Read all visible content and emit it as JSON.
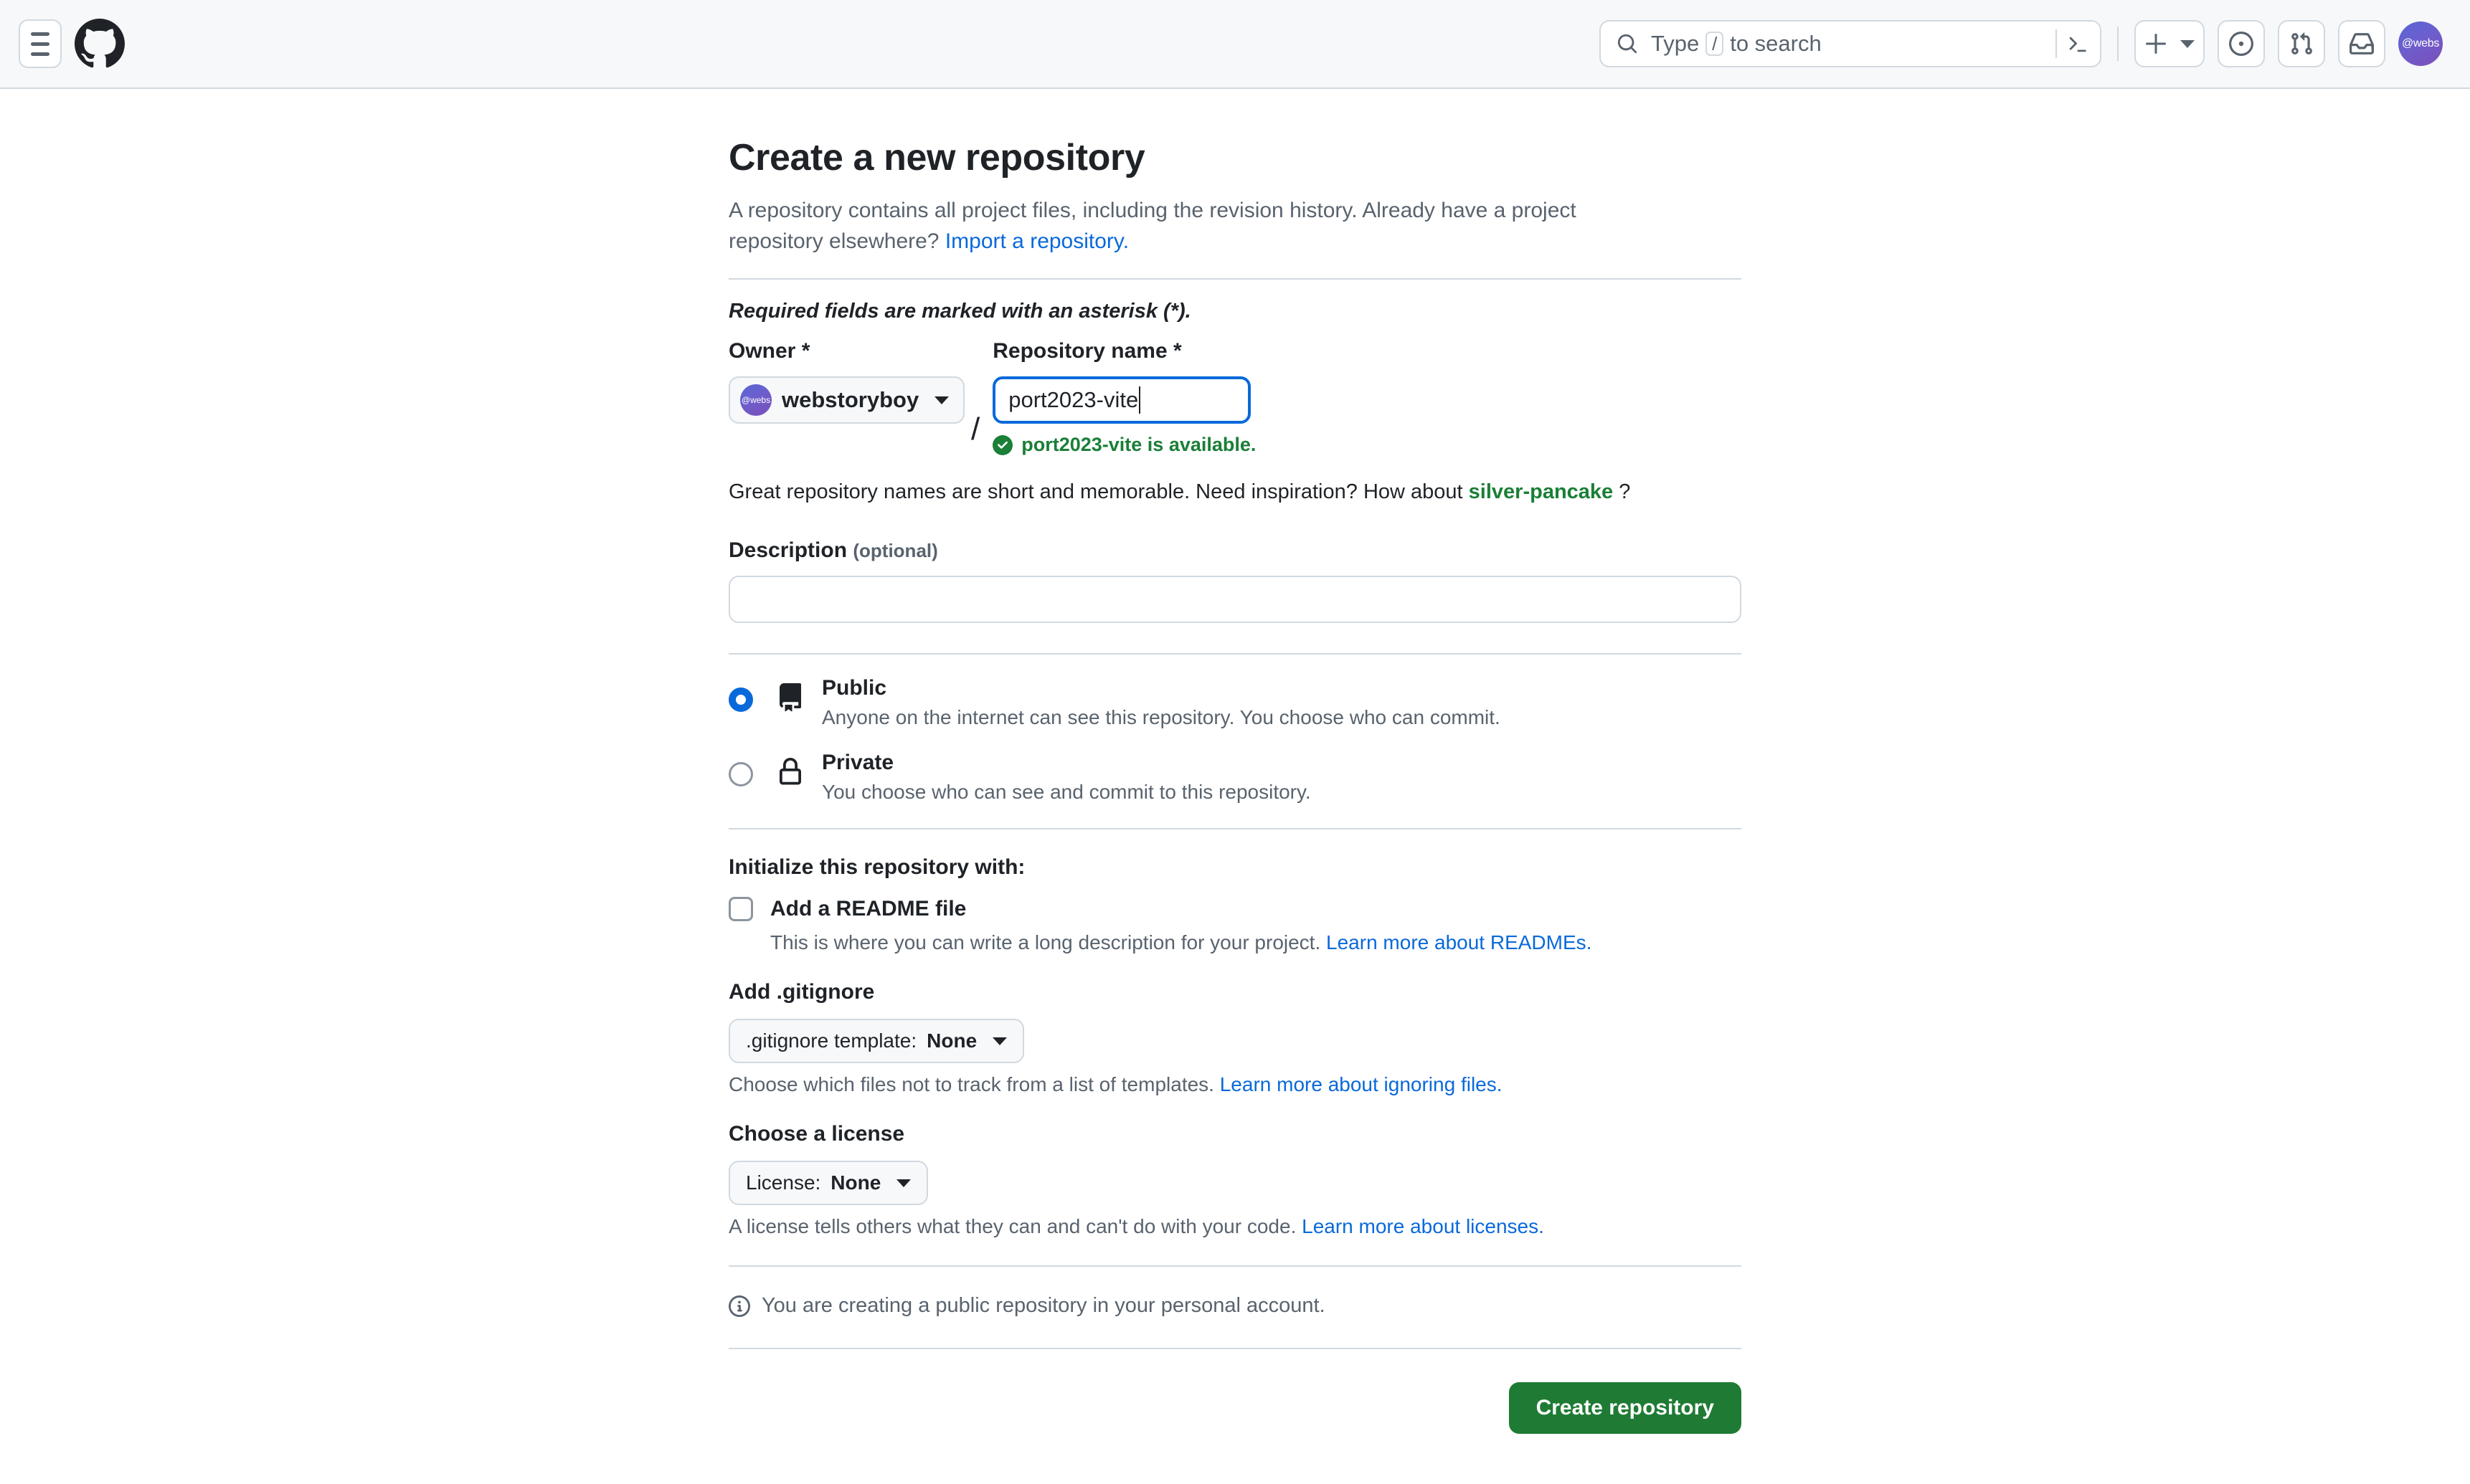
{
  "header": {
    "menu_icon": "hamburger-icon",
    "logo_icon": "github-logo-icon",
    "search": {
      "icon": "search-icon",
      "placeholder_prefix": "Type",
      "key_hint": "/",
      "placeholder_suffix": "to search",
      "terminal_icon": "terminal-icon"
    },
    "create_new_icon": "plus-icon",
    "issues_icon": "issue-opened-icon",
    "pull_requests_icon": "git-pull-request-icon",
    "notifications_icon": "inbox-icon",
    "avatar_label": "@webs"
  },
  "page": {
    "title": "Create a new repository",
    "lede_part1": "A repository contains all project files, including the revision history. Already have a project repository elsewhere?",
    "lede_link": "Import a repository.",
    "required_note": "Required fields are marked with an asterisk (*)."
  },
  "owner": {
    "label": "Owner *",
    "avatar_label": "@webs",
    "value": "webstoryboy",
    "caret_icon": "chevron-down-icon",
    "separator": "/"
  },
  "repo_name": {
    "label": "Repository name *",
    "value": "port2023-vite",
    "availability_icon": "check-circle-fill-icon",
    "availability_text": "port2023-vite is available."
  },
  "inspiration": {
    "text_prefix": "Great repository names are short and memorable. Need inspiration? How about",
    "suggestion": "silver-pancake",
    "text_suffix": "?"
  },
  "description": {
    "label": "Description",
    "optional": "(optional)",
    "value": "",
    "placeholder": ""
  },
  "visibility": {
    "options": [
      {
        "name": "Public",
        "icon": "repo-icon",
        "description": "Anyone on the internet can see this repository. You choose who can commit.",
        "selected": true
      },
      {
        "name": "Private",
        "icon": "lock-icon",
        "description": "You choose who can see and commit to this repository.",
        "selected": false
      }
    ]
  },
  "initialize": {
    "title": "Initialize this repository with:",
    "readme": {
      "label": "Add a README file",
      "checked": false,
      "hint_text": "This is where you can write a long description for your project.",
      "hint_link": "Learn more about READMEs."
    }
  },
  "gitignore": {
    "title": "Add .gitignore",
    "button_prefix": ".gitignore template:",
    "button_value": "None",
    "caret_icon": "chevron-down-icon",
    "hint_text": "Choose which files not to track from a list of templates.",
    "hint_link": "Learn more about ignoring files."
  },
  "license": {
    "title": "Choose a license",
    "button_prefix": "License:",
    "button_value": "None",
    "caret_icon": "chevron-down-icon",
    "hint_text": "A license tells others what they can and can't do with your code.",
    "hint_link": "Learn more about licenses."
  },
  "footer": {
    "info_icon": "info-icon",
    "info_text": "You are creating a public repository in your personal account.",
    "submit_label": "Create repository"
  },
  "colors": {
    "link": "#0969da",
    "success": "#1a7f37",
    "primary_button": "#1f7b34",
    "border": "#d1d9e0",
    "muted_text": "#59636e",
    "text": "#1f2328"
  }
}
